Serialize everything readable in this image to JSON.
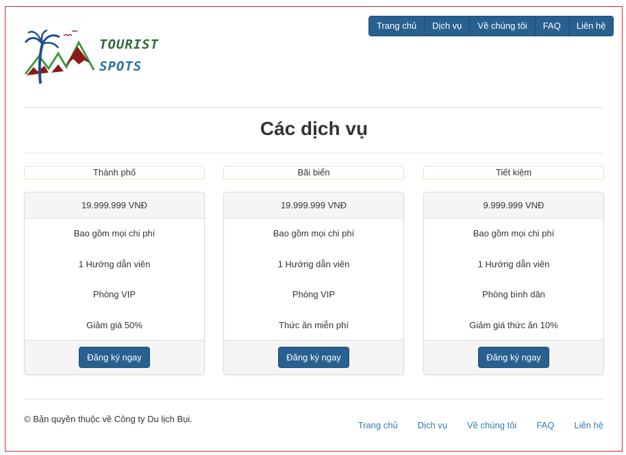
{
  "nav": {
    "items": [
      {
        "label": "Trang chủ"
      },
      {
        "label": "Dịch vụ"
      },
      {
        "label": "Về chúng tôi"
      },
      {
        "label": "FAQ"
      },
      {
        "label": "Liên hệ"
      }
    ]
  },
  "logo": {
    "line1": "TOURIST",
    "line2": "SPOTS"
  },
  "page": {
    "title": "Các dịch vụ"
  },
  "packages": [
    {
      "category": "Thành phố",
      "price": "19.999.999 VNĐ",
      "features": [
        "Bao gồm mọi chi phí",
        "1 Hướng dẫn viên",
        "Phòng VIP",
        "Giảm giá 50%"
      ],
      "button": "Đăng ký ngay"
    },
    {
      "category": "Bãi biển",
      "price": "19.999.999 VNĐ",
      "features": [
        "Bao gồm mọi chi phí",
        "1 Hướng dẫn viên",
        "Phòng VIP",
        "Thức ăn miễn phí"
      ],
      "button": "Đăng ký ngay"
    },
    {
      "category": "Tiết kiệm",
      "price": "9.999.999 VNĐ",
      "features": [
        "Bao gồm mọi chi phí",
        "1 Hướng dẫn viên",
        "Phòng bình dân",
        "Giảm giá thức ăn 10%"
      ],
      "button": "Đăng ký ngay"
    }
  ],
  "footer": {
    "copyright": "© Bản quyền thuộc về Công ty Du lịch Bụi.",
    "links": [
      {
        "label": "Trang chủ"
      },
      {
        "label": "Dịch vụ"
      },
      {
        "label": "Về chúng tôi"
      },
      {
        "label": "FAQ"
      },
      {
        "label": "Liên hệ"
      }
    ]
  },
  "colors": {
    "primary": "#286090",
    "link": "#337ab7",
    "frame_border": "#c9302c"
  }
}
